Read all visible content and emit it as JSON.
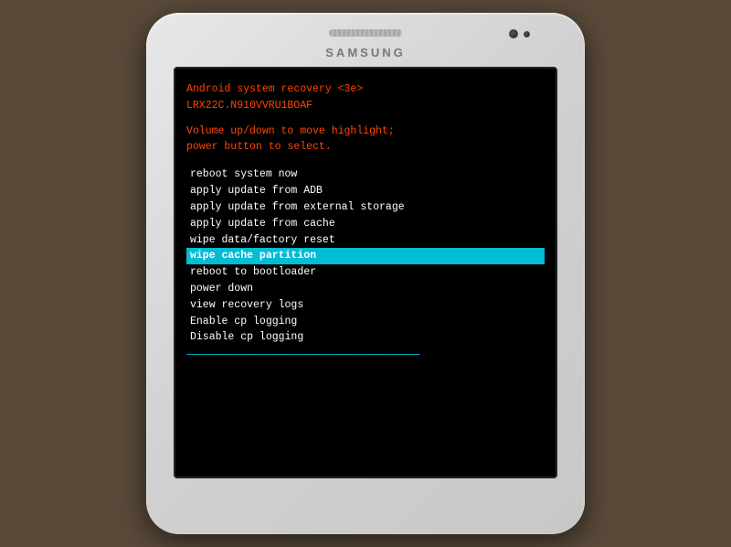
{
  "phone": {
    "brand": "SAMSUNG"
  },
  "screen": {
    "header": {
      "line1": "Android system recovery <3e>",
      "line2": "LRX22C.N910VVRU1BOAF"
    },
    "instructions": {
      "line1": "Volume up/down to move highlight;",
      "line2": "power button to select."
    },
    "menu": {
      "items": [
        {
          "label": "reboot system now",
          "highlighted": false
        },
        {
          "label": "apply update from ADB",
          "highlighted": false
        },
        {
          "label": "apply update from external storage",
          "highlighted": false
        },
        {
          "label": "apply update from cache",
          "highlighted": false
        },
        {
          "label": "wipe data/factory reset",
          "highlighted": false
        },
        {
          "label": "wipe cache partition",
          "highlighted": true
        },
        {
          "label": "reboot to bootloader",
          "highlighted": false
        },
        {
          "label": "power down",
          "highlighted": false
        },
        {
          "label": "view recovery logs",
          "highlighted": false
        },
        {
          "label": "Enable cp logging",
          "highlighted": false
        },
        {
          "label": "Disable cp logging",
          "highlighted": false
        }
      ]
    }
  }
}
